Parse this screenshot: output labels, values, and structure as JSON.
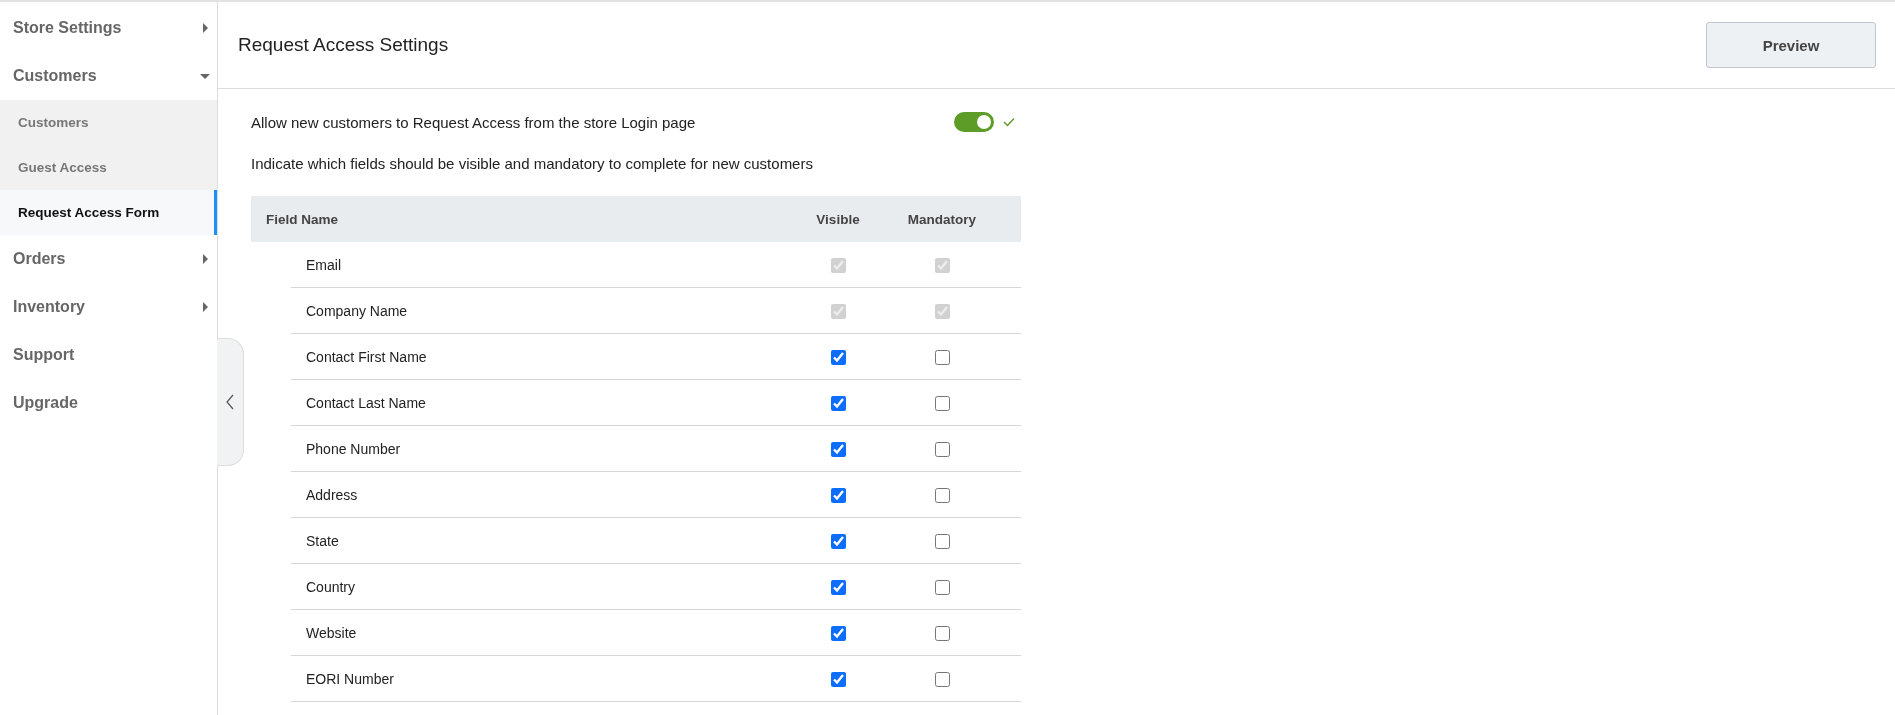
{
  "sidebar": {
    "items": [
      {
        "label": "Store Settings",
        "kind": "group",
        "expanded": false
      },
      {
        "label": "Customers",
        "kind": "group",
        "expanded": true,
        "children": [
          {
            "label": "Customers",
            "selected": false
          },
          {
            "label": "Guest Access",
            "selected": false
          },
          {
            "label": "Request Access Form",
            "selected": true
          }
        ]
      },
      {
        "label": "Orders",
        "kind": "group",
        "expanded": false
      },
      {
        "label": "Inventory",
        "kind": "group",
        "expanded": false
      },
      {
        "label": "Support",
        "kind": "link",
        "expanded": false
      },
      {
        "label": "Upgrade",
        "kind": "link",
        "expanded": false
      }
    ]
  },
  "header": {
    "title": "Request Access Settings",
    "button": "Preview"
  },
  "allow_toggle": {
    "label": "Allow new customers to Request Access from the store Login page",
    "on": true
  },
  "instructions": "Indicate which fields should be visible and mandatory to complete for new customers",
  "table": {
    "columns": [
      "Field Name",
      "Visible",
      "Mandatory"
    ],
    "rows": [
      {
        "name": "Email",
        "visible": true,
        "mandatory": true,
        "disabled": true
      },
      {
        "name": "Company Name",
        "visible": true,
        "mandatory": true,
        "disabled": true
      },
      {
        "name": "Contact First Name",
        "visible": true,
        "mandatory": false,
        "disabled": false
      },
      {
        "name": "Contact Last Name",
        "visible": true,
        "mandatory": false,
        "disabled": false
      },
      {
        "name": "Phone Number",
        "visible": true,
        "mandatory": false,
        "disabled": false
      },
      {
        "name": "Address",
        "visible": true,
        "mandatory": false,
        "disabled": false
      },
      {
        "name": "State",
        "visible": true,
        "mandatory": false,
        "disabled": false
      },
      {
        "name": "Country",
        "visible": true,
        "mandatory": false,
        "disabled": false
      },
      {
        "name": "Website",
        "visible": true,
        "mandatory": false,
        "disabled": false
      },
      {
        "name": "EORI Number",
        "visible": true,
        "mandatory": false,
        "disabled": false
      }
    ]
  }
}
